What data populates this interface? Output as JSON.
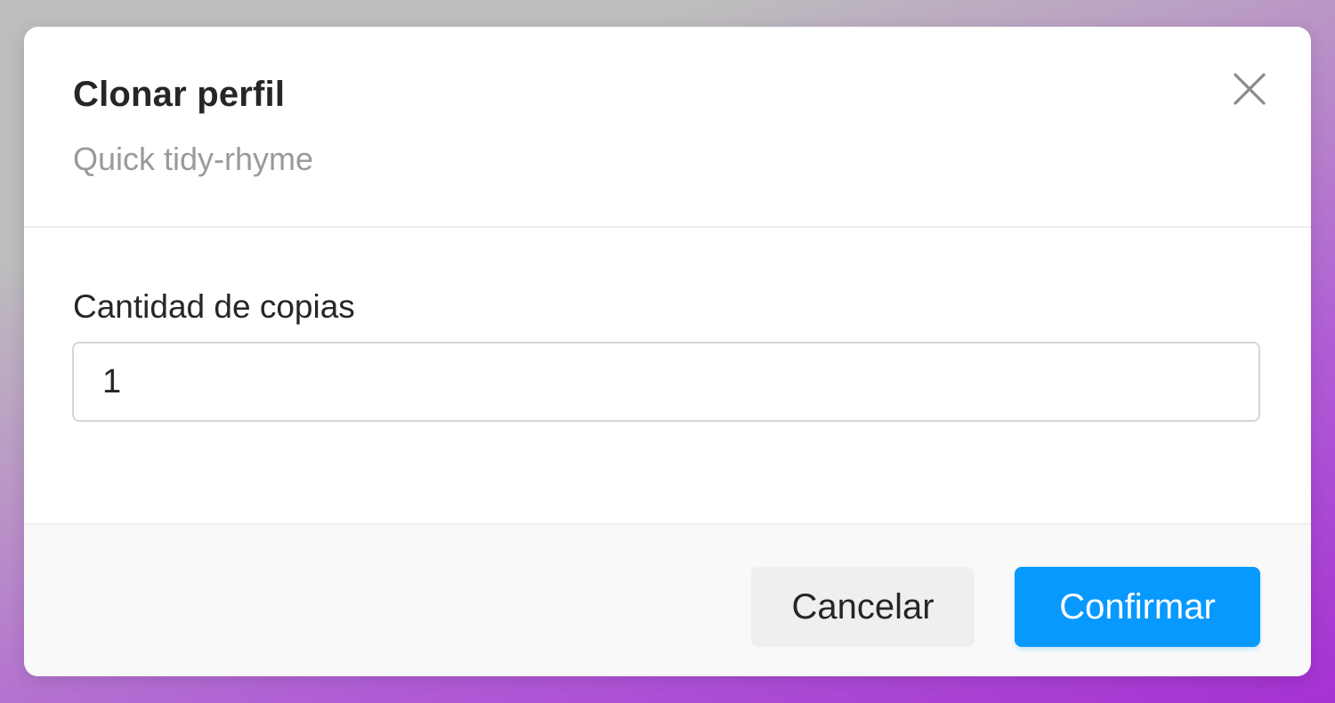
{
  "dialog": {
    "title": "Clonar perfil",
    "subtitle": "Quick tidy-rhyme",
    "close_icon": "close-icon"
  },
  "form": {
    "copies_label": "Cantidad de copias",
    "copies_value": "1"
  },
  "footer": {
    "cancel_label": "Cancelar",
    "confirm_label": "Confirmar"
  },
  "colors": {
    "accent": "#0899ff",
    "text": "#262626",
    "muted": "#9a9a9a"
  }
}
